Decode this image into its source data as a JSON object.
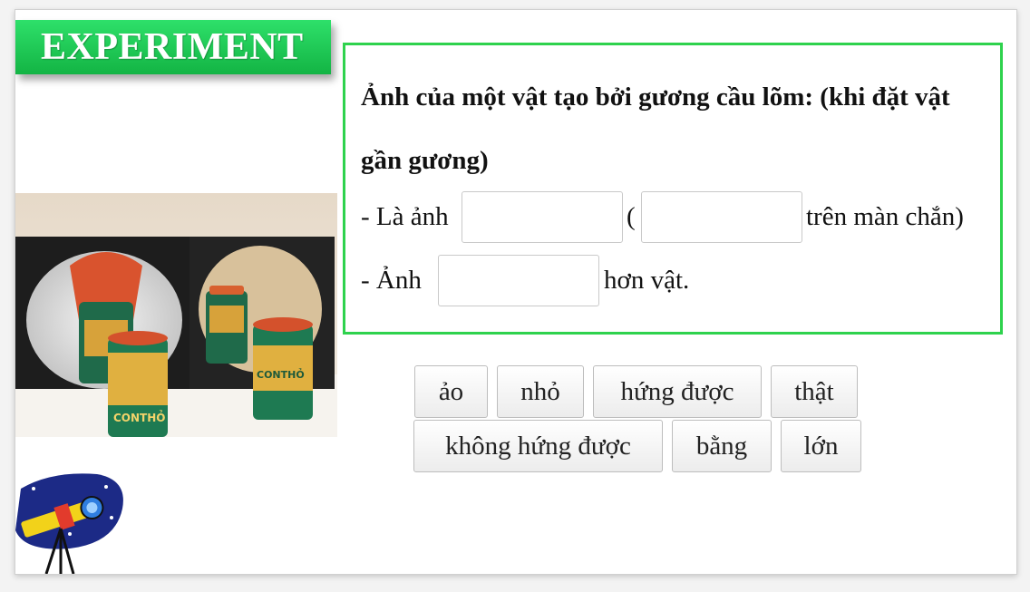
{
  "badge": {
    "label": "EXPERIMENT"
  },
  "question": {
    "title": "Ảnh của một vật tạo bởi gương cầu lõm: (khi đặt vật gần gương)",
    "line1_prefix": "- Là ảnh",
    "line1_paren_open": "(",
    "line1_suffix": "trên màn chắn)",
    "line2_prefix": "- Ảnh",
    "line2_suffix": "hơn vật."
  },
  "word_bank": [
    "ảo",
    "nhỏ",
    "hứng được",
    "thật",
    "không hứng được",
    "bằng",
    "lớn"
  ],
  "photo": {
    "brand_text": "CONTHỎ"
  },
  "colors": {
    "badge": "#17c24b",
    "box_border": "#2ed24d"
  }
}
